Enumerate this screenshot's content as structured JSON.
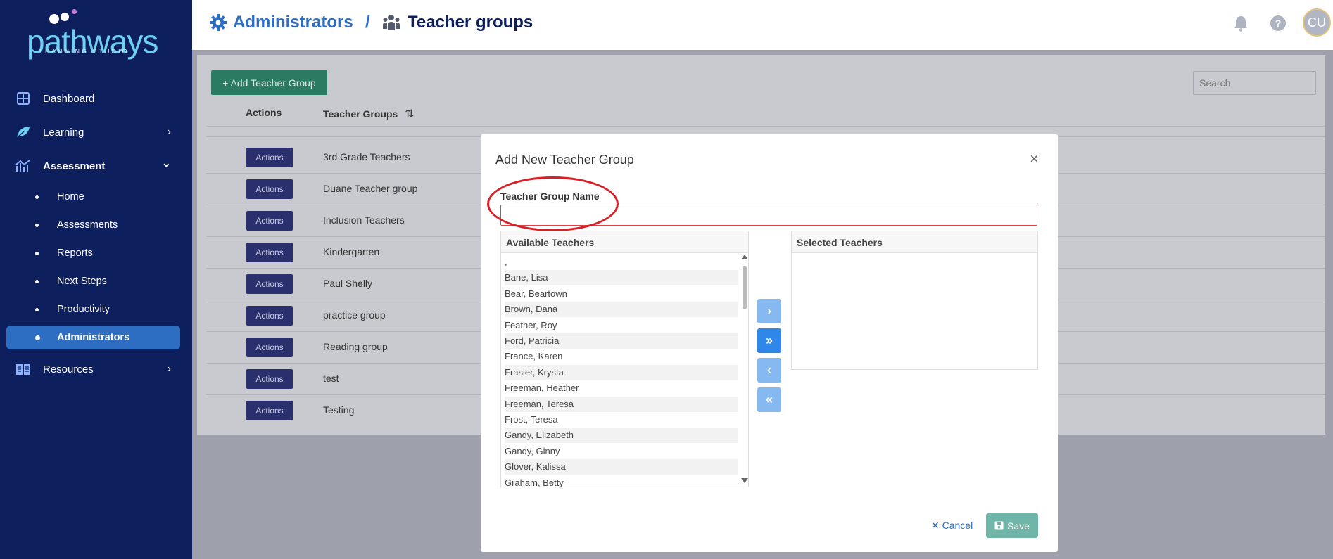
{
  "brand": {
    "name": "pathways",
    "tagline": "LEARNING STUDIO"
  },
  "sidebar": {
    "items": [
      {
        "label": "Dashboard",
        "icon": "grid-icon"
      },
      {
        "label": "Learning",
        "icon": "leaf-icon",
        "chevron": "›"
      },
      {
        "label": "Assessment",
        "icon": "chart-icon",
        "chevron": "⌄"
      },
      {
        "label": "Resources",
        "icon": "book-icon",
        "chevron": "›"
      }
    ],
    "assessment_sub": [
      {
        "label": "Home"
      },
      {
        "label": "Assessments"
      },
      {
        "label": "Reports"
      },
      {
        "label": "Next Steps"
      },
      {
        "label": "Productivity"
      },
      {
        "label": "Administrators",
        "active": true
      }
    ]
  },
  "header": {
    "crumb1": "Administrators",
    "separator": "/",
    "crumb2": "Teacher groups",
    "avatar_initials": "CU"
  },
  "toolbar": {
    "add_label": "+ Add Teacher Group",
    "search_placeholder": "Search"
  },
  "table": {
    "col_actions": "Actions",
    "col_groups": "Teacher Groups",
    "sort_icon": "⇅",
    "action_label": "Actions",
    "rows": [
      "3rd Grade Teachers",
      "Duane Teacher group",
      "Inclusion Teachers",
      "Kindergarten",
      "Paul Shelly",
      "practice group",
      "Reading group",
      "test",
      "Testing"
    ]
  },
  "modal": {
    "title": "Add New Teacher Group",
    "close": "×",
    "field_label": "Teacher Group Name",
    "field_value": "",
    "available_title": "Available Teachers",
    "selected_title": "Selected Teachers",
    "available": [
      ",",
      "Bane, Lisa",
      "Bear, Beartown",
      "Brown, Dana",
      "Feather, Roy",
      "Ford, Patricia",
      "France, Karen",
      "Frasier, Krysta",
      "Freeman, Heather",
      "Freeman, Teresa",
      "Frost, Teresa",
      "Gandy, Elizabeth",
      "Gandy, Ginny",
      "Glover, Kalissa",
      "Graham, Betty"
    ],
    "move_one": "›",
    "move_all": "»",
    "remove_one": "‹",
    "remove_all": "«",
    "cancel_label": "Cancel",
    "save_label": "Save"
  },
  "colors": {
    "sidebar_bg": "#0d1f5c",
    "accent_blue": "#2d6dc2",
    "add_green": "#2b7a62",
    "save_teal": "#6fb5a8",
    "highlight_red": "#d91f26"
  }
}
